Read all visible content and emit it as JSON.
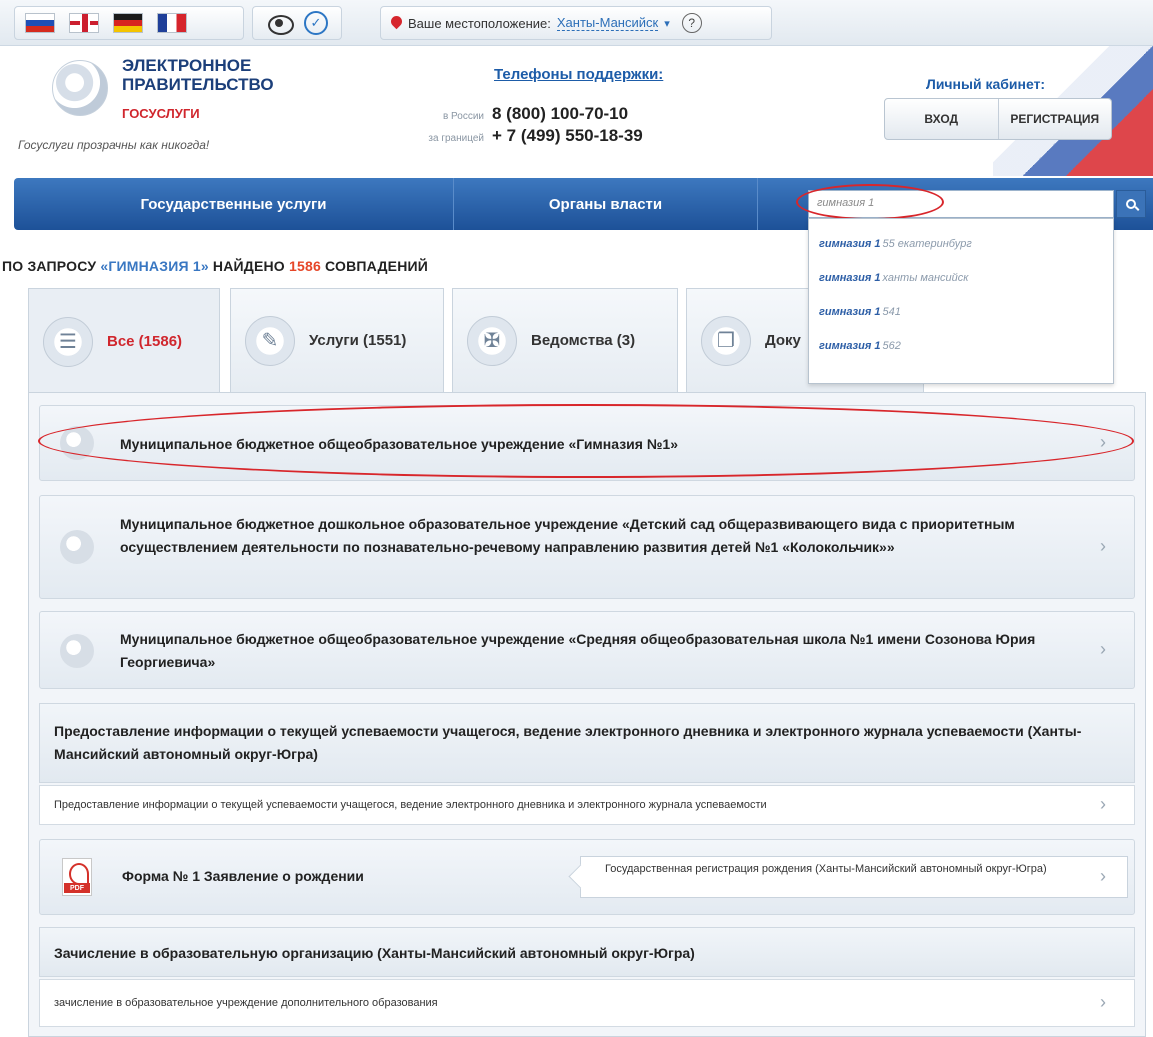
{
  "topbar": {
    "flags": [
      "flag-russia",
      "flag-uk",
      "flag-germany",
      "flag-france"
    ],
    "accessibility_icons": [
      "eye-icon",
      "compass-icon"
    ],
    "location_label": "Ваше местоположение:",
    "location_city": "Ханты-Мансийск",
    "location_chevron": "▾",
    "help_label": "?"
  },
  "header": {
    "logo_title": "ЭЛЕКТРОННОЕ ПРАВИТЕЛЬСТВО",
    "logo_sub": "ГОСУСЛУГИ",
    "slogan": "Госуслуги прозрачны как никогда!",
    "phones_title": "Телефоны поддержки:",
    "phones": [
      {
        "label": "в России",
        "number": "8 (800) 100-70-10"
      },
      {
        "label": "за границей",
        "number": "+ 7 (499) 550-18-39"
      }
    ],
    "cabinet_title": "Личный кабинет:",
    "login_label": "ВХОД",
    "register_label": "РЕГИСТРАЦИЯ"
  },
  "nav": {
    "items": [
      "Государственные услуги",
      "Органы власти"
    ],
    "search_value": "гимназия 1",
    "suggestions": [
      {
        "bold": "гимназия 1",
        "rest": "55 екатеринбург"
      },
      {
        "bold": "гимназия 1",
        "rest": " ханты мансийск"
      },
      {
        "bold": "гимназия 1",
        "rest": "541"
      },
      {
        "bold": "гимназия 1",
        "rest": "562"
      }
    ]
  },
  "query": {
    "prefix": "ПО ЗАПРОСУ ",
    "term": "«ГИМНАЗИЯ 1»",
    "middle": " НАЙДЕНО ",
    "count": "1586",
    "suffix": " СОВПАДЕНИЙ"
  },
  "tabs": [
    {
      "label": "Все (1586)",
      "icon": "document-icon",
      "active": true
    },
    {
      "label": "Услуги (1551)",
      "icon": "services-icon",
      "active": false
    },
    {
      "label": "Ведомства (3)",
      "icon": "emblem-icon",
      "active": false
    },
    {
      "label": "Доку",
      "icon": "documents-icon",
      "active": false
    }
  ],
  "results": {
    "organizations": [
      "Муниципальное бюджетное общеобразовательное учреждение «Гимназия №1»",
      "Муниципальное бюджетное дошкольное образовательное учреждение «Детский сад общеразвивающего вида с приоритетным осуществлением деятельности по познавательно-речевому направлению развития детей №1 «Колокольчик»»",
      "Муниципальное бюджетное общеобразовательное учреждение «Средняя общеобразовательная школа №1 имени Созонова Юрия Георгиевича»"
    ],
    "service1_title": "Предоставление информации о текущей успеваемости учащегося, ведение электронного дневника и электронного журнала успеваемости (Ханты-Мансийский автономный округ-Югра)",
    "service1_sub": "Предоставление информации о текущей успеваемости учащегося, ведение электронного дневника и электронного журнала успеваемости",
    "form_label": "Форма № 1 Заявление о рождении",
    "form_tag": "PDF",
    "form_service": "Государственная регистрация рождения (Ханты-Мансийский автономный округ-Югра)",
    "service2_title": "Зачисление в образовательную организацию (Ханты-Мансийский автономный округ-Югра)",
    "service2_sub": "зачисление в образовательное учреждение дополнительного образования",
    "chevron": "›"
  },
  "colors": {
    "nav_blue": "#1d5198",
    "accent_red": "#d0262d",
    "link_blue": "#1d5ca8"
  }
}
